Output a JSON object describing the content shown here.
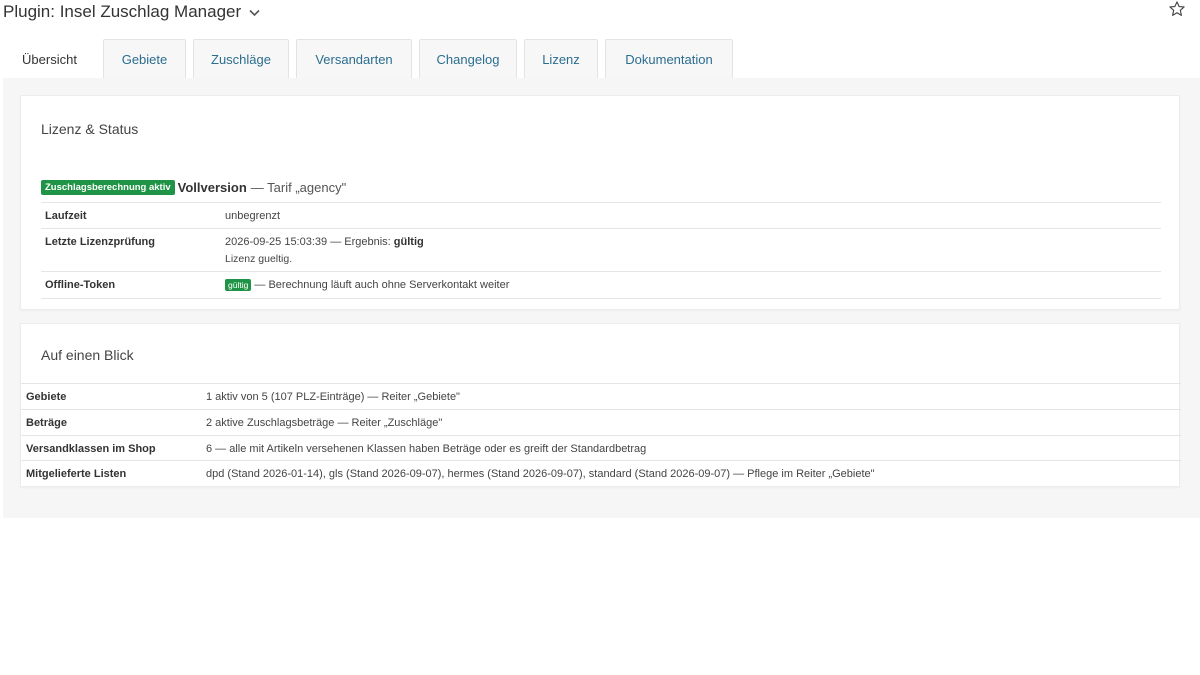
{
  "header": {
    "title": "Plugin: Insel Zuschlag Manager",
    "chevron_icon": "chevron-down-icon",
    "star_icon": "star-icon"
  },
  "tabs": [
    {
      "label": "Übersicht",
      "active": true
    },
    {
      "label": "Gebiete",
      "active": false
    },
    {
      "label": "Zuschläge",
      "active": false
    },
    {
      "label": "Versandarten",
      "active": false
    },
    {
      "label": "Changelog",
      "active": false
    },
    {
      "label": "Lizenz",
      "active": false
    },
    {
      "label": "Dokumentation",
      "active": false
    }
  ],
  "license": {
    "title": "Lizenz & Status",
    "badge": "Zuschlagsberechnung aktiv",
    "version": "Vollversion",
    "tarif": "— Tarif „agency\"",
    "rows": [
      {
        "key": "Laufzeit",
        "value": "unbegrenzt"
      },
      {
        "key": "Letzte Lizenzprüfung",
        "value_prefix": "2026-09-25 15:03:39 — Ergebnis:",
        "value_bold": "gültig",
        "sub": "Lizenz gueltig."
      },
      {
        "key": "Offline-Token",
        "badge": "gültig",
        "value": "— Berechnung läuft auch ohne Serverkontakt weiter"
      }
    ]
  },
  "glance": {
    "title": "Auf einen Blick",
    "rows": [
      {
        "key": "Gebiete",
        "value": "1 aktiv von 5 (107 PLZ-Einträge) — Reiter „Gebiete\""
      },
      {
        "key": "Beträge",
        "value": "2 aktive Zuschlagsbeträge — Reiter „Zuschläge\""
      },
      {
        "key": "Versandklassen im Shop",
        "value": "6 — alle mit Artikeln versehenen Klassen haben Beträge oder es greift der Standardbetrag"
      },
      {
        "key": "Mitgelieferte Listen",
        "value": "dpd (Stand 2026-01-14), gls (Stand 2026-09-07), hermes (Stand 2026-09-07), standard (Stand 2026-09-07) — Pflege im Reiter „Gebiete\""
      }
    ]
  },
  "colors": {
    "accent_link": "#2b6d8f",
    "badge_green": "#1f9446",
    "panel_bg": "#f6f6f6"
  }
}
